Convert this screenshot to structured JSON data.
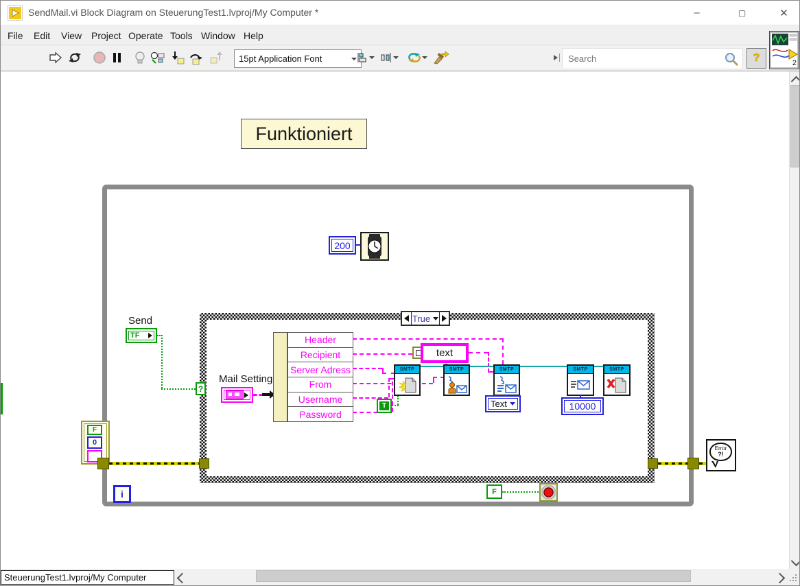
{
  "window": {
    "title": "SendMail.vi Block Diagram on SteuerungTest1.lvproj/My Computer *",
    "controls": {
      "minimize": "–",
      "maximize": "▢",
      "close": "✕"
    }
  },
  "menu": {
    "items": [
      "File",
      "Edit",
      "View",
      "Project",
      "Operate",
      "Tools",
      "Window",
      "Help"
    ]
  },
  "toolbar": {
    "font_selector": "15pt Application Font",
    "search_placeholder": "Search",
    "help_label": "?",
    "vi_badge": "2",
    "icons": [
      "run",
      "run-continuously",
      "abort",
      "pause",
      "highlight-execution",
      "retain-wire-values",
      "step-into",
      "step-over",
      "step-out",
      "align-objects",
      "distribute-objects",
      "reorder",
      "cleanup-diagram",
      "search",
      "help"
    ]
  },
  "diagram": {
    "comment_label": "Funktioniert",
    "wait_ms_constant": "200",
    "case_selector_value": "True",
    "case_selector_terminal": "?",
    "send": {
      "label": "Send",
      "terminal": "TF"
    },
    "mail_setting": {
      "label": "Mail Setting"
    },
    "unbundle_fields": [
      "Header",
      "Recipient",
      "Server Adress",
      "From",
      "Username",
      "Password"
    ],
    "text_constant": "text",
    "smtp_label": "SMTP",
    "message_type_constant": "Text",
    "timeout_constant": "10000",
    "true_constant": "T",
    "false_constant": "F",
    "iteration_terminal": "i",
    "error_cluster_constant": {
      "status": "F",
      "code": "0"
    },
    "error_handler": {
      "line1": "Error",
      "line2": "?!"
    }
  },
  "statusbar": {
    "context_label": "SteuerungTest1.lvproj/My Computer"
  },
  "colors": {
    "string_pink": "#fb00fb",
    "boolean_green": "#0a9a0a",
    "numeric_blue": "#2222dd",
    "error_olive": "#d2d200",
    "smtp_cyan": "#00b9e9",
    "label_yellow": "#fcf8d3",
    "loop_gray": "#8a8a8a"
  }
}
